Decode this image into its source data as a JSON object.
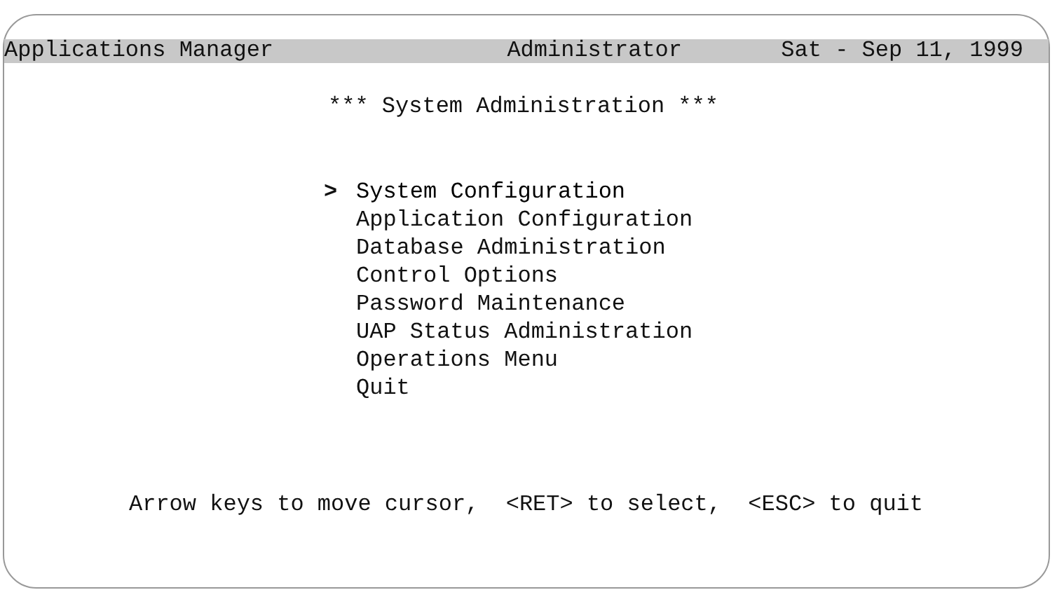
{
  "header": {
    "left": "Applications Manager",
    "center": "Administrator",
    "right": "Sat - Sep 11, 1999"
  },
  "title": "*** System Administration ***",
  "cursor": ">",
  "menu": [
    {
      "label": "System Configuration",
      "selected": true
    },
    {
      "label": "Application Configuration",
      "selected": false
    },
    {
      "label": "Database Administration",
      "selected": false
    },
    {
      "label": "Control Options",
      "selected": false
    },
    {
      "label": "Password Maintenance",
      "selected": false
    },
    {
      "label": "UAP Status Administration",
      "selected": false
    },
    {
      "label": "Operations Menu",
      "selected": false
    },
    {
      "label": "Quit",
      "selected": false
    }
  ],
  "hint": "Arrow keys to move cursor,  <RET> to select,  <ESC> to quit"
}
